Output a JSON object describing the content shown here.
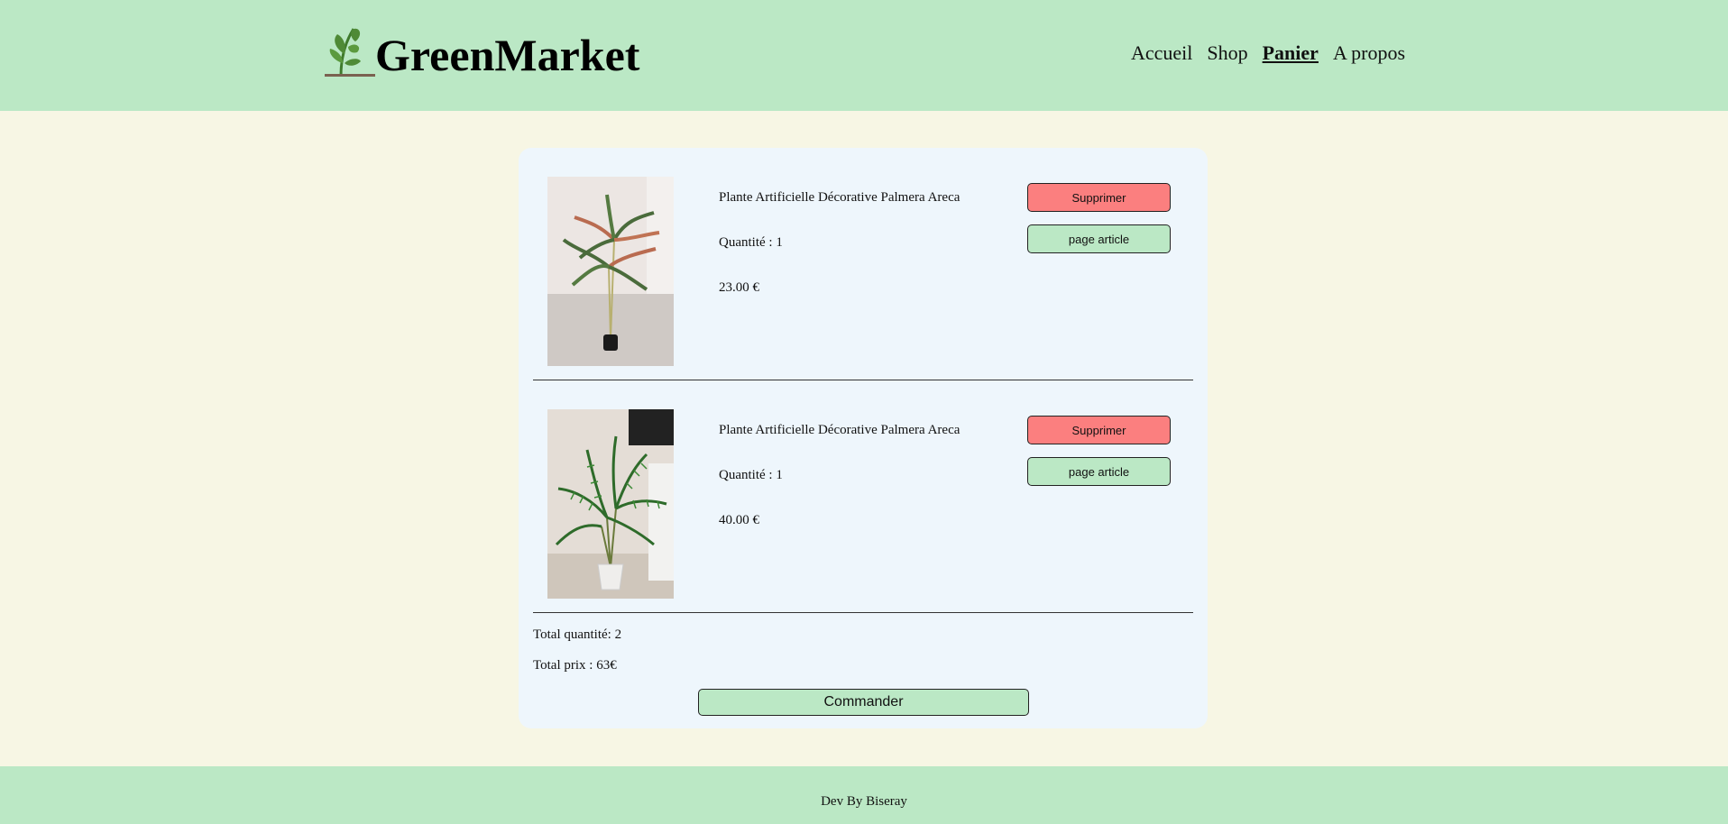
{
  "header": {
    "brand": "GreenMarket",
    "nav": [
      "Accueil",
      "Shop",
      "Panier",
      "A propos"
    ],
    "active_nav": "Panier"
  },
  "cart": {
    "items": [
      {
        "name": "Plante Artificielle Décorative Palmera Areca",
        "quantity": "Quantité : 1",
        "price": "23.00 €",
        "delete_label": "Supprimer",
        "view_label": "page article",
        "image_icon": "dracaena-plant-photo"
      },
      {
        "name": "Plante Artificielle Décorative Palmera Areca",
        "quantity": "Quantité : 1",
        "price": "40.00 €",
        "delete_label": "Supprimer",
        "view_label": "page article",
        "image_icon": "areca-palm-photo"
      }
    ],
    "total_quantity": "Total quantité: 2",
    "total_price": "Total prix : 63€",
    "order_label": "Commander"
  },
  "footer": {
    "credit": "Dev By Biseray"
  },
  "colors": {
    "header_bg": "#bbe8c5",
    "page_bg": "#f7f6e4",
    "card_bg": "#eef6fc",
    "delete_button": "#fb7f7f",
    "primary_button": "#bbe8c5"
  }
}
